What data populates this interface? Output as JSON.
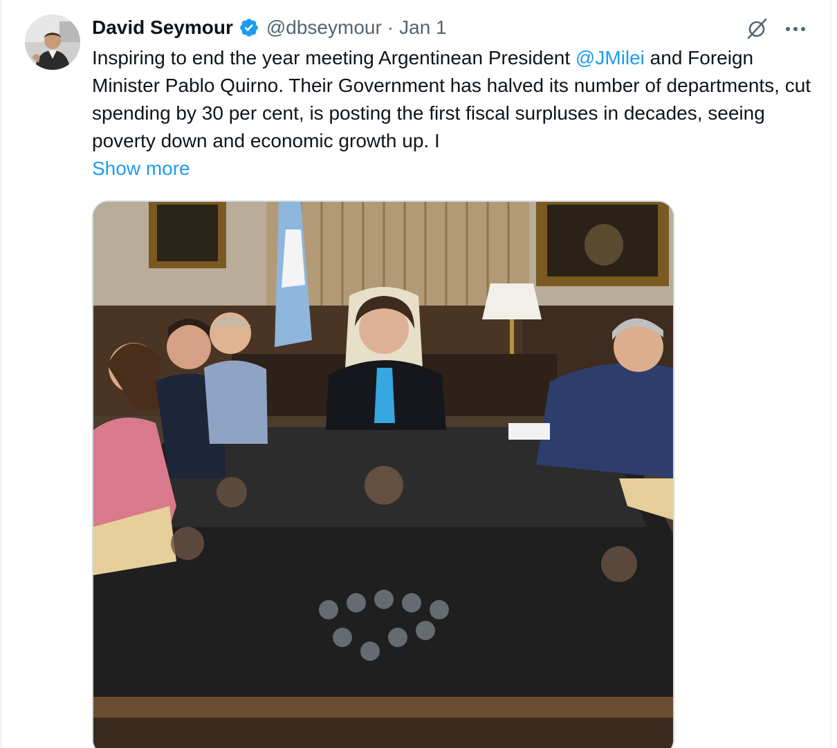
{
  "tweet": {
    "display_name": "David Seymour",
    "handle": "@dbseymour",
    "separator": "·",
    "date": "Jan 1",
    "text_part1": "Inspiring to end the year meeting Argentinean President ",
    "mention": "@JMilei",
    "text_part2": " and Foreign Minister Pablo Quirno. Their Government has halved its number of departments, cut spending by 30 per cent, is posting the first fiscal surpluses in decades, seeing poverty down and economic growth up. I",
    "show_more": "Show more",
    "icons": {
      "verified": "verified-badge-icon",
      "grok": "grok-icon",
      "more": "more-options-icon"
    }
  },
  "colors": {
    "text": "#0f1419",
    "secondary": "#536471",
    "link": "#1d9bf0",
    "verified": "#1d9bf0",
    "border": "#cfd9de"
  }
}
